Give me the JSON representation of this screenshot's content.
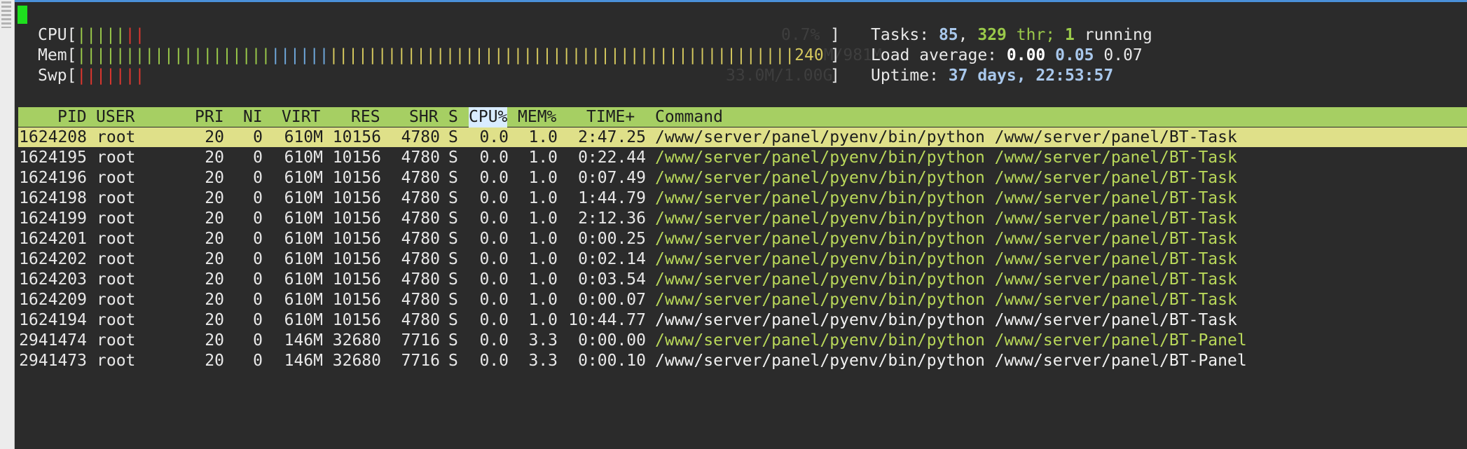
{
  "meters": {
    "cpu_label": "CPU",
    "cpu_bars": [
      "|||||",
      "||"
    ],
    "cpu_value": "0.7%",
    "mem_label": "Mem",
    "mem_bars_green": "||||||||||||||||||||",
    "mem_bars_blue": "||||||",
    "mem_bars_yellow": "||||||||||||||||||||||||||||||||||||||||||||||||",
    "mem_value_visible": "240",
    "mem_value_hidden": "M/981M",
    "swp_label": "Swp",
    "swp_bars": "|||||||",
    "swp_value": "33.0M/1.00G"
  },
  "stats": {
    "tasks_label": "Tasks:",
    "tasks_count": "85",
    "thr_count": "329",
    "thr_label": "thr;",
    "running_count": "1",
    "running_label": "running",
    "load_label": "Load average:",
    "load_1": "0.00",
    "load_5": "0.05",
    "load_15": "0.07",
    "uptime_label": "Uptime:",
    "uptime_value": "37 days, 22:53:57"
  },
  "table": {
    "headers": [
      "PID",
      "USER",
      "PRI",
      "NI",
      "VIRT",
      "RES",
      "SHR",
      "S",
      "CPU%",
      "MEM%",
      "TIME+",
      "Command"
    ],
    "sorted_column": "CPU%",
    "rows": [
      {
        "pid": "1624208",
        "user": "root",
        "pri": "20",
        "ni": "0",
        "virt": "610M",
        "res": "10156",
        "shr": "4780",
        "s": "S",
        "cpu": "0.0",
        "mem": "1.0",
        "time": "2:47.25",
        "cmd": "/www/server/panel/pyenv/bin/python /www/server/panel/BT-Task",
        "selected": true,
        "thread": false
      },
      {
        "pid": "1624195",
        "user": "root",
        "pri": "20",
        "ni": "0",
        "virt": "610M",
        "res": "10156",
        "shr": "4780",
        "s": "S",
        "cpu": "0.0",
        "mem": "1.0",
        "time": "0:22.44",
        "cmd": "/www/server/panel/pyenv/bin/python /www/server/panel/BT-Task",
        "selected": false,
        "thread": true
      },
      {
        "pid": "1624196",
        "user": "root",
        "pri": "20",
        "ni": "0",
        "virt": "610M",
        "res": "10156",
        "shr": "4780",
        "s": "S",
        "cpu": "0.0",
        "mem": "1.0",
        "time": "0:07.49",
        "cmd": "/www/server/panel/pyenv/bin/python /www/server/panel/BT-Task",
        "selected": false,
        "thread": true
      },
      {
        "pid": "1624198",
        "user": "root",
        "pri": "20",
        "ni": "0",
        "virt": "610M",
        "res": "10156",
        "shr": "4780",
        "s": "S",
        "cpu": "0.0",
        "mem": "1.0",
        "time": "1:44.79",
        "cmd": "/www/server/panel/pyenv/bin/python /www/server/panel/BT-Task",
        "selected": false,
        "thread": true
      },
      {
        "pid": "1624199",
        "user": "root",
        "pri": "20",
        "ni": "0",
        "virt": "610M",
        "res": "10156",
        "shr": "4780",
        "s": "S",
        "cpu": "0.0",
        "mem": "1.0",
        "time": "2:12.36",
        "cmd": "/www/server/panel/pyenv/bin/python /www/server/panel/BT-Task",
        "selected": false,
        "thread": true
      },
      {
        "pid": "1624201",
        "user": "root",
        "pri": "20",
        "ni": "0",
        "virt": "610M",
        "res": "10156",
        "shr": "4780",
        "s": "S",
        "cpu": "0.0",
        "mem": "1.0",
        "time": "0:00.25",
        "cmd": "/www/server/panel/pyenv/bin/python /www/server/panel/BT-Task",
        "selected": false,
        "thread": true
      },
      {
        "pid": "1624202",
        "user": "root",
        "pri": "20",
        "ni": "0",
        "virt": "610M",
        "res": "10156",
        "shr": "4780",
        "s": "S",
        "cpu": "0.0",
        "mem": "1.0",
        "time": "0:02.14",
        "cmd": "/www/server/panel/pyenv/bin/python /www/server/panel/BT-Task",
        "selected": false,
        "thread": true
      },
      {
        "pid": "1624203",
        "user": "root",
        "pri": "20",
        "ni": "0",
        "virt": "610M",
        "res": "10156",
        "shr": "4780",
        "s": "S",
        "cpu": "0.0",
        "mem": "1.0",
        "time": "0:03.54",
        "cmd": "/www/server/panel/pyenv/bin/python /www/server/panel/BT-Task",
        "selected": false,
        "thread": true
      },
      {
        "pid": "1624209",
        "user": "root",
        "pri": "20",
        "ni": "0",
        "virt": "610M",
        "res": "10156",
        "shr": "4780",
        "s": "S",
        "cpu": "0.0",
        "mem": "1.0",
        "time": "0:00.07",
        "cmd": "/www/server/panel/pyenv/bin/python /www/server/panel/BT-Task",
        "selected": false,
        "thread": true
      },
      {
        "pid": "1624194",
        "user": "root",
        "pri": "20",
        "ni": "0",
        "virt": "610M",
        "res": "10156",
        "shr": "4780",
        "s": "S",
        "cpu": "0.0",
        "mem": "1.0",
        "time": "10:44.77",
        "cmd": "/www/server/panel/pyenv/bin/python /www/server/panel/BT-Task",
        "selected": false,
        "thread": false
      },
      {
        "pid": "2941474",
        "user": "root",
        "pri": "20",
        "ni": "0",
        "virt": "146M",
        "res": "32680",
        "shr": "7716",
        "s": "S",
        "cpu": "0.0",
        "mem": "3.3",
        "time": "0:00.00",
        "cmd": "/www/server/panel/pyenv/bin/python /www/server/panel/BT-Panel",
        "selected": false,
        "thread": true
      },
      {
        "pid": "2941473",
        "user": "root",
        "pri": "20",
        "ni": "0",
        "virt": "146M",
        "res": "32680",
        "shr": "7716",
        "s": "S",
        "cpu": "0.0",
        "mem": "3.3",
        "time": "0:00.10",
        "cmd": "/www/server/panel/pyenv/bin/python /www/server/panel/BT-Panel",
        "selected": false,
        "thread": false
      }
    ]
  },
  "colors": {
    "background": "#2b2b2b",
    "header_bar": "#a6cf63",
    "selected_row": "#dfe089",
    "thread_command": "#b9d85a",
    "cursor": "#1ee01e"
  }
}
